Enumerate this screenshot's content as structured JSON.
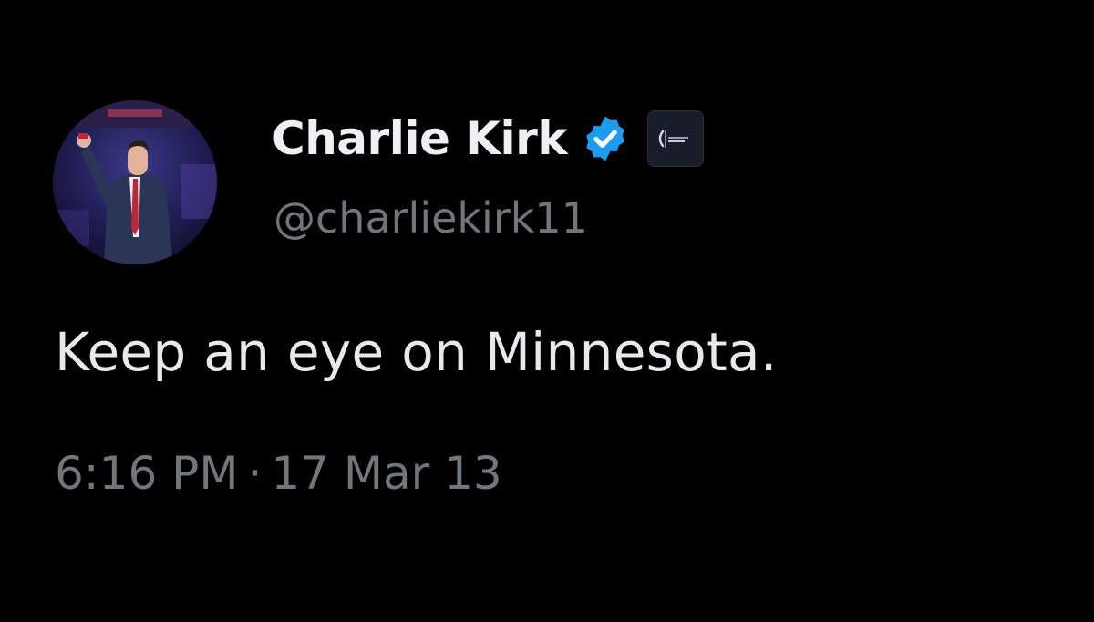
{
  "tweet": {
    "author": {
      "display_name": "Charlie Kirk",
      "handle": "@charliekirk11",
      "verified": true,
      "verified_badge_color": "#1d9bf0",
      "avatar_icon": "profile-photo",
      "affiliate_icon": "organization-badge-icon"
    },
    "text": "Keep an eye on Minnesota.",
    "time": "6:16 PM",
    "separator": "·",
    "date": "17 Mar 13"
  },
  "colors": {
    "background": "#000000",
    "primary_text": "#e7e9ea",
    "secondary_text": "#71767b"
  }
}
